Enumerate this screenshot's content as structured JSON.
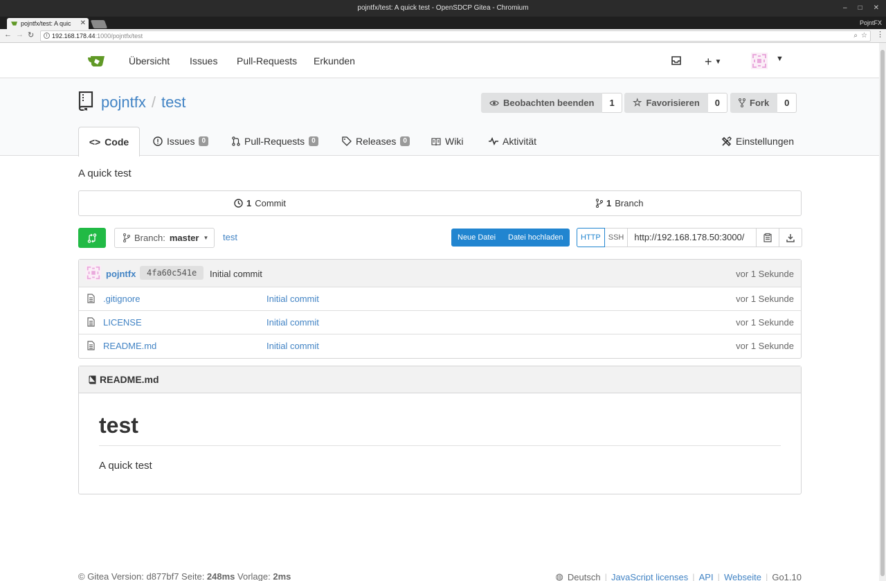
{
  "browser": {
    "window_title": "pojntfx/test: A quick test - OpenSDCP Gitea - Chromium",
    "tab_title": "pojntfx/test: A quic",
    "profile": "PojntFX",
    "url_host": "192.168.178.44",
    "url_rest": ":1000/pojntfx/test"
  },
  "nav": {
    "overview": "Übersicht",
    "issues": "Issues",
    "pulls": "Pull-Requests",
    "explore": "Erkunden"
  },
  "repo": {
    "owner": "pojntfx",
    "separator": "/",
    "name": "test",
    "description": "A quick test",
    "watch_label": "Beobachten beenden",
    "watch_count": "1",
    "star_label": "Favorisieren",
    "star_count": "0",
    "fork_label": "Fork",
    "fork_count": "0"
  },
  "tabs": {
    "code": "Code",
    "issues": "Issues",
    "issues_count": "0",
    "pulls": "Pull-Requests",
    "pulls_count": "0",
    "releases": "Releases",
    "releases_count": "0",
    "wiki": "Wiki",
    "activity": "Aktivität",
    "settings": "Einstellungen"
  },
  "stats": {
    "commits_num": "1",
    "commits_label": "Commit",
    "branches_num": "1",
    "branches_label": "Branch"
  },
  "toolbar": {
    "branch_prefix": "Branch:",
    "branch_name": "master",
    "breadcrumb": "test",
    "new_file": "Neue Datei",
    "upload_file": "Datei hochladen",
    "http": "HTTP",
    "ssh": "SSH",
    "clone_url": "http://192.168.178.50:3000/"
  },
  "latest_commit": {
    "author": "pojntfx",
    "sha": "4fa60c541e",
    "message": "Initial commit",
    "time": "vor 1 Sekunde"
  },
  "files": [
    {
      "name": ".gitignore",
      "message": "Initial commit",
      "time": "vor 1 Sekunde"
    },
    {
      "name": "LICENSE",
      "message": "Initial commit",
      "time": "vor 1 Sekunde"
    },
    {
      "name": "README.md",
      "message": "Initial commit",
      "time": "vor 1 Sekunde"
    }
  ],
  "readme": {
    "filename": "README.md",
    "heading": "test",
    "body": "A quick test"
  },
  "footer": {
    "version_prefix": "© Gitea Version: d877bf7 Seite: ",
    "page_time": "248ms",
    "template_prefix": " Vorlage: ",
    "template_time": "2ms",
    "language": "Deutsch",
    "js_licenses": "JavaScript licenses",
    "api": "API",
    "website": "Webseite",
    "go_version": "Go1.10"
  },
  "colors": {
    "link": "#4183c4",
    "primary_blue": "#2185d0",
    "green": "#21ba45",
    "gitea_green": "#609926"
  }
}
